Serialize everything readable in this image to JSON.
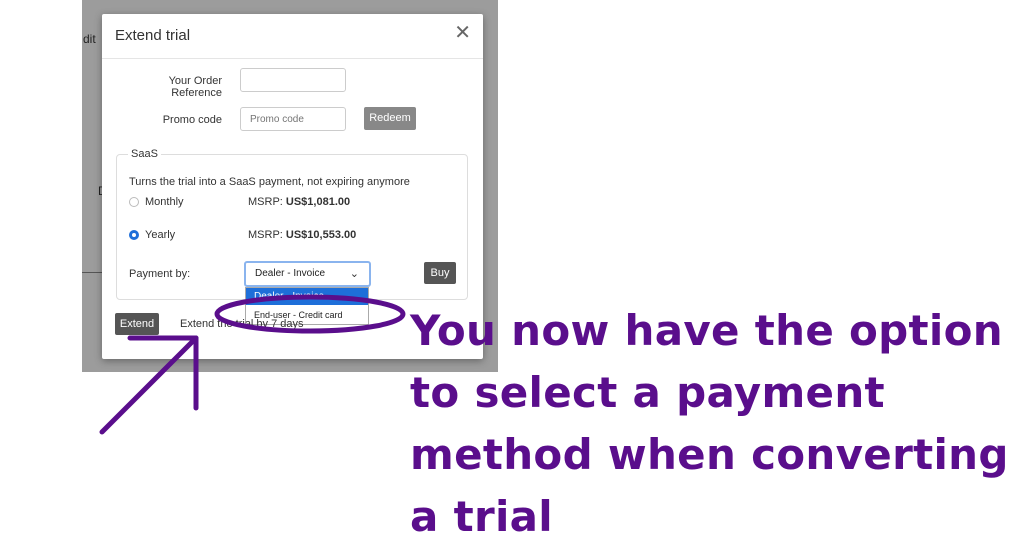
{
  "background": {
    "partial_text": "dit",
    "partial_char": "D"
  },
  "modal": {
    "title": "Extend trial",
    "close_icon": "close-icon",
    "order_reference_label": "Your Order Reference",
    "order_reference_value": "",
    "promo_code_label": "Promo code",
    "promo_code_placeholder": "Promo code",
    "redeem_label": "Redeem",
    "saas": {
      "legend": "SaaS",
      "description": "Turns the trial into a SaaS payment, not expiring anymore",
      "options": [
        {
          "label": "Monthly",
          "msrp_label": "MSRP:",
          "msrp_value": "US$1,081.00",
          "selected": false
        },
        {
          "label": "Yearly",
          "msrp_label": "MSRP:",
          "msrp_value": "US$10,553.00",
          "selected": true
        }
      ],
      "payment_label": "Payment by:",
      "payment_selected": "Dealer - Invoice",
      "payment_options": [
        "Dealer - Invoice",
        "End-user - Credit card"
      ],
      "buy_label": "Buy"
    },
    "footer": {
      "extend_label": "Extend",
      "extend_text": "Extend the trial by 7 days"
    }
  },
  "annotation": {
    "text": "You now have the option to select a payment method when converting a trial",
    "color": "#5a0e8c"
  }
}
